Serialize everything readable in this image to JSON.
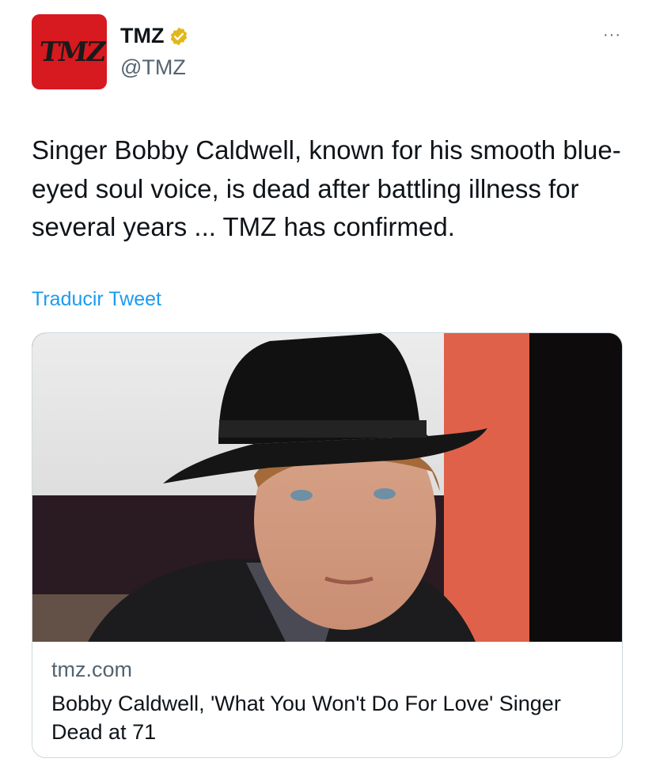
{
  "author": {
    "avatar_text": "TMZ",
    "display_name": "TMZ",
    "handle": "@TMZ",
    "verified": true,
    "verified_icon": "gold-verified-badge-icon",
    "avatar_color": "#d71920"
  },
  "more_icon": "more-options-icon",
  "more_glyph": "···",
  "tweet": {
    "text": "Singer Bobby Caldwell, known for his smooth blue-eyed soul voice, is dead after battling illness for several years ... TMZ has confirmed.",
    "translate_label": "Traducir Tweet"
  },
  "card": {
    "domain": "tmz.com",
    "title": "Bobby Caldwell, 'What You Won't Do For Love' Singer Dead at 71"
  },
  "colors": {
    "link": "#1d9bf0",
    "secondary_text": "#536471",
    "verified_gold": "#e2b719",
    "border": "#cfd9de"
  }
}
